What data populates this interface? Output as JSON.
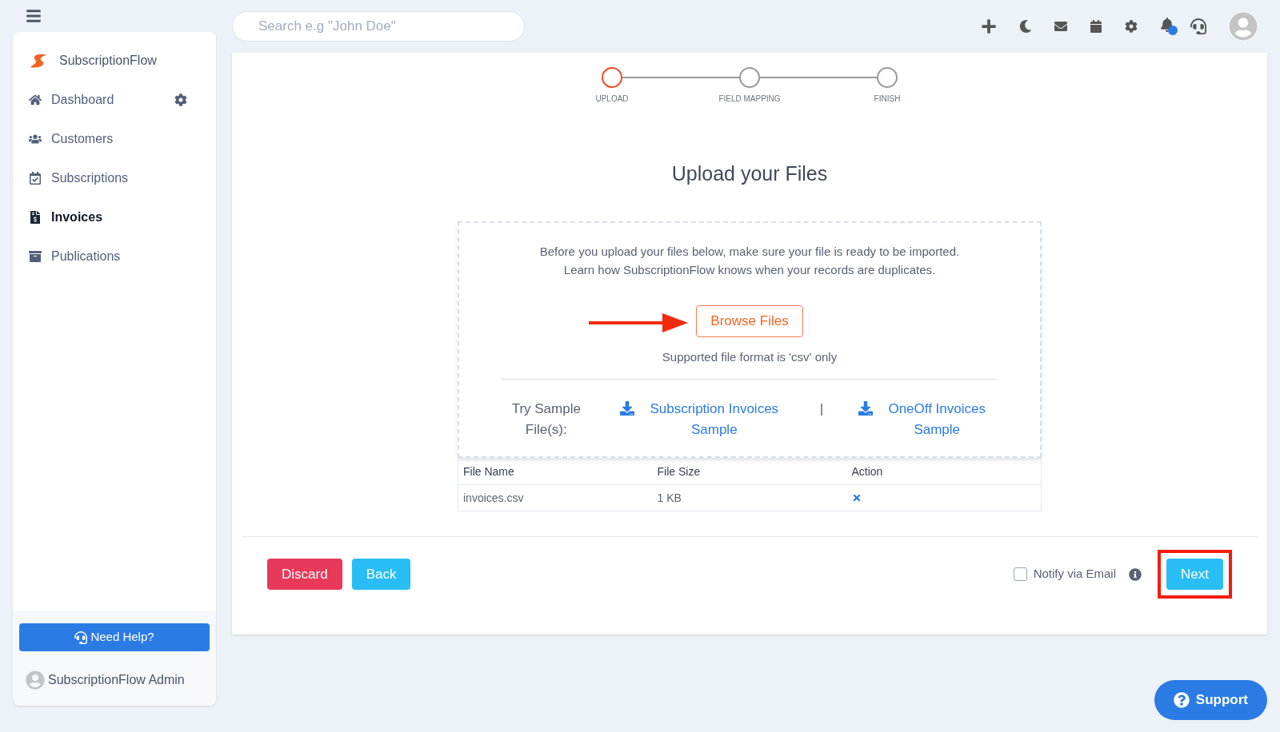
{
  "top_bar": {
    "search": {
      "placeholder": "Search e.g \"John Doe\""
    }
  },
  "sidebar": {
    "brand": "SubscriptionFlow",
    "items": [
      {
        "label": "Dashboard",
        "selected": false
      },
      {
        "label": "Customers",
        "selected": false
      },
      {
        "label": "Subscriptions",
        "selected": false
      },
      {
        "label": "Invoices",
        "selected": true
      },
      {
        "label": "Publications",
        "selected": false
      }
    ],
    "help_button": "Need Help?",
    "user": "SubscriptionFlow Admin"
  },
  "stepper": [
    {
      "label": "UPLOAD",
      "selected": true
    },
    {
      "label": "FIELD MAPPING",
      "selected": false
    },
    {
      "label": "FINISH",
      "selected": false
    }
  ],
  "title": "Upload your Files",
  "dropzone": {
    "intro": [
      "Before you upload your files below, make sure your file is ready to be imported.",
      "Learn how SubscriptionFlow knows when your records are duplicates."
    ],
    "browse_button": "Browse Files",
    "format_note": "Supported file format is 'csv' only",
    "samples_label": "Try Sample File(s):",
    "separator": "|",
    "sample_links": [
      "Subscription Invoices Sample",
      "OneOff Invoices Sample"
    ]
  },
  "table": {
    "columns": [
      "File Name",
      "File Size",
      "Action"
    ],
    "rows": [
      {
        "name": "invoices.csv",
        "size": "1 KB"
      }
    ]
  },
  "footer": {
    "discard": "Discard",
    "back": "Back",
    "notify": {
      "label": "Notify via Email",
      "checked": false
    },
    "next": "Next"
  },
  "support_button": "Support"
}
